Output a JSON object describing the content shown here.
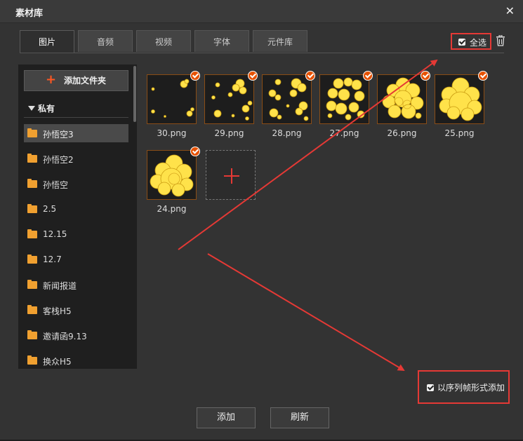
{
  "window": {
    "title": "素材库"
  },
  "tabs": [
    {
      "label": "图片",
      "active": true
    },
    {
      "label": "音频"
    },
    {
      "label": "视频"
    },
    {
      "label": "字体"
    },
    {
      "label": "元件库"
    }
  ],
  "toolbar": {
    "select_all_label": "全选"
  },
  "sidebar": {
    "add_folder_label": "添加文件夹",
    "section_label": "私有",
    "folders": [
      "孙悟空3",
      "孙悟空2",
      "孙悟空",
      "2.5",
      "12.15",
      "12.7",
      "新闻报道",
      "客栈H5",
      "邀请函9.13",
      "换众H5"
    ]
  },
  "images": [
    "30.png",
    "29.png",
    "28.png",
    "27.png",
    "26.png",
    "25.png",
    "24.png"
  ],
  "footer": {
    "sequence_label": "以序列帧形式添加",
    "add_label": "添加",
    "refresh_label": "刷新"
  },
  "colors": {
    "accent": "#e53935",
    "folder": "#f0a030",
    "smoke": "#ffe24a"
  }
}
